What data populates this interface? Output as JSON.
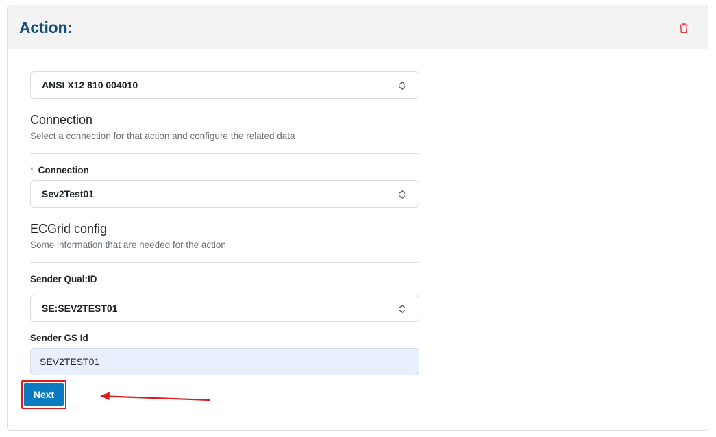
{
  "header": {
    "title": "Action:",
    "delete_icon": "trash-icon"
  },
  "document_type": {
    "value": "ANSI X12 810 004010"
  },
  "connection_section": {
    "title": "Connection",
    "description": "Select a connection for that action and configure the related data",
    "field_label": "Connection",
    "required_marker": "*",
    "value": "Sev2Test01"
  },
  "ecgrid_section": {
    "title": "ECGrid config",
    "description": "Some information that are needed for the action",
    "sender_qual_label": "Sender Qual:ID",
    "sender_qual_value": "SE:SEV2TEST01",
    "sender_gs_label": "Sender GS Id",
    "sender_gs_value": "SEV2TEST01"
  },
  "actions": {
    "next_label": "Next"
  },
  "colors": {
    "title": "#0e4f77",
    "primary_button": "#0b7ac0",
    "highlight": "#e01b1b",
    "required": "#e0393e",
    "autofill_bg": "#e8f0fe"
  }
}
